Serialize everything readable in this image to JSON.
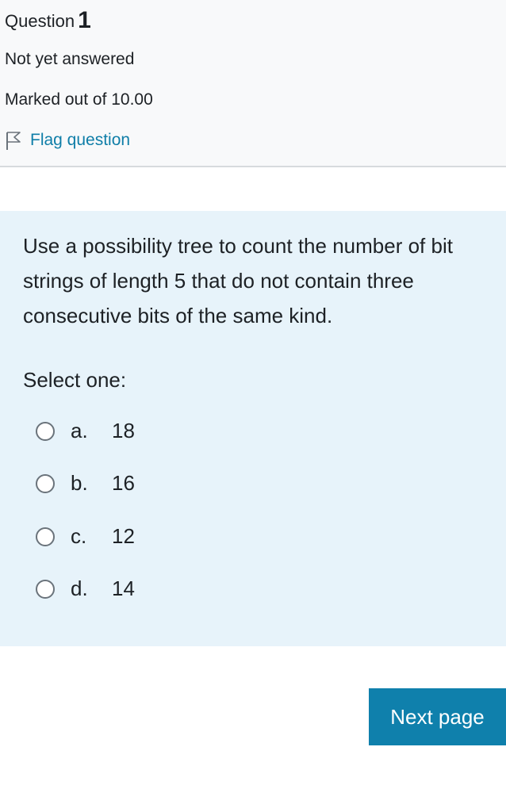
{
  "info": {
    "question_label": "Question",
    "question_number": "1",
    "state": "Not yet answered",
    "grade": "Marked out of 10.00",
    "flag_label": "Flag question"
  },
  "question": {
    "text": "Use a possibility tree to count  the number of bit strings of length 5 that do not contain three consecutive bits of the same kind.",
    "prompt": "Select one:",
    "answers": [
      {
        "letter": "a.",
        "text": "18"
      },
      {
        "letter": "b.",
        "text": "16"
      },
      {
        "letter": "c.",
        "text": "12"
      },
      {
        "letter": "d.",
        "text": "14"
      }
    ]
  },
  "navigation": {
    "next_label": "Next page"
  },
  "colors": {
    "link": "#0f7ea8",
    "button": "#0f80ac",
    "question_bg": "#e7f3fa",
    "info_bg": "#f8f9fa"
  },
  "icons": {
    "flag": "flag-outline-icon"
  }
}
